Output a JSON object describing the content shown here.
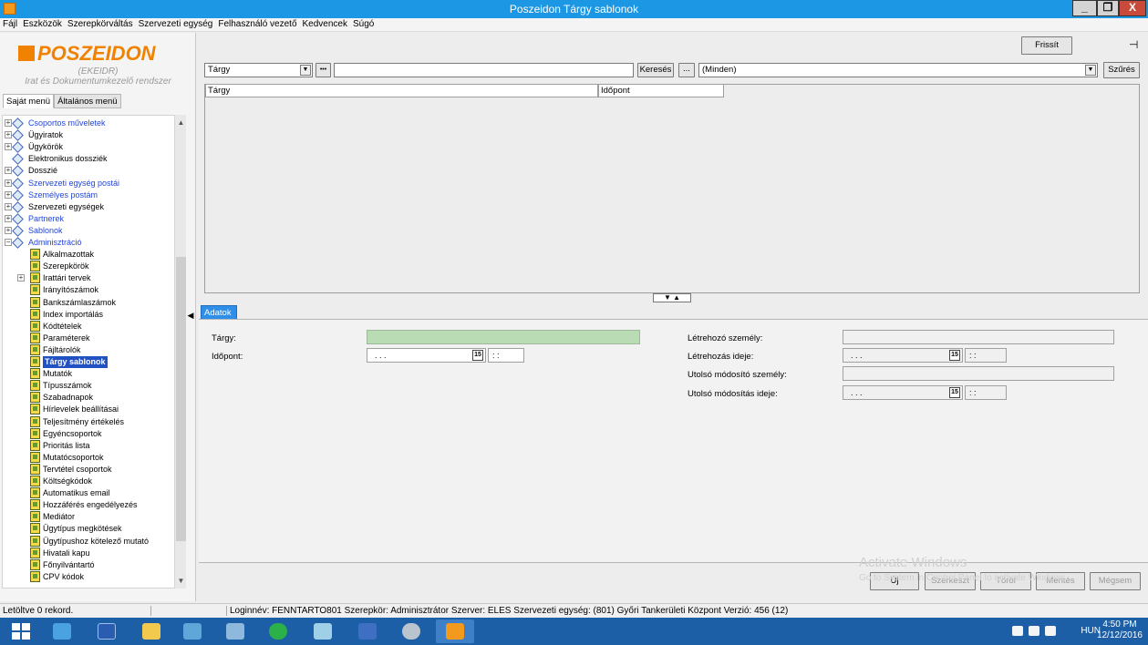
{
  "window": {
    "title": "Poszeidon Tárgy sablonok",
    "min": "_",
    "max": "❐",
    "close": "X"
  },
  "menu": [
    "Fájl",
    "Eszközök",
    "Szerepkörváltás",
    "Szervezeti egység",
    "Felhasználó vezető",
    "Kedvencek",
    "Súgó"
  ],
  "logo": {
    "name": "POSZEIDON",
    "sub1": "(EKEIDR)",
    "sub2": "Irat és Dokumentumkezelő rendszer"
  },
  "left_tabs": {
    "own": "Saját menü",
    "general": "Általános menü"
  },
  "tree": [
    {
      "label": "Csoportos műveletek",
      "type": "folder",
      "expand": "+",
      "blue": true
    },
    {
      "label": "Ügyiratok",
      "type": "folder",
      "expand": "+",
      "blue": false
    },
    {
      "label": "Ügykörök",
      "type": "folder",
      "expand": "+",
      "blue": false
    },
    {
      "label": "Elektronikus dossziék",
      "type": "folder",
      "expand": "",
      "blue": false
    },
    {
      "label": "Dosszié",
      "type": "folder",
      "expand": "+",
      "blue": false
    },
    {
      "label": "Szervezeti egység postái",
      "type": "folder",
      "expand": "+",
      "blue": true
    },
    {
      "label": "Személyes postám",
      "type": "folder",
      "expand": "+",
      "blue": true
    },
    {
      "label": "Szervezeti egységek",
      "type": "folder",
      "expand": "+",
      "blue": false
    },
    {
      "label": "Partnerek",
      "type": "folder",
      "expand": "+",
      "blue": true
    },
    {
      "label": "Sablonok",
      "type": "folder",
      "expand": "+",
      "blue": true
    },
    {
      "label": "Adminisztráció",
      "type": "folder",
      "expand": "−",
      "blue": true
    },
    {
      "label": "Alkalmazottak",
      "type": "doc"
    },
    {
      "label": "Szerepkörök",
      "type": "doc"
    },
    {
      "label": "Irattári tervek",
      "type": "doc",
      "expand": "+"
    },
    {
      "label": "Irányítószámok",
      "type": "doc"
    },
    {
      "label": "Bankszámlaszámok",
      "type": "doc"
    },
    {
      "label": "Index importálás",
      "type": "doc"
    },
    {
      "label": "Kódtételek",
      "type": "doc"
    },
    {
      "label": "Paraméterek",
      "type": "doc"
    },
    {
      "label": "Fájltárolók",
      "type": "doc"
    },
    {
      "label": "Tárgy sablonok",
      "type": "doc",
      "selected": true
    },
    {
      "label": "Mutatók",
      "type": "doc"
    },
    {
      "label": "Típusszámok",
      "type": "doc"
    },
    {
      "label": "Szabadnapok",
      "type": "doc"
    },
    {
      "label": "Hírlevelek beállításai",
      "type": "doc"
    },
    {
      "label": "Teljesítmény értékelés",
      "type": "doc"
    },
    {
      "label": "Egyéncsoportok",
      "type": "doc"
    },
    {
      "label": "Prioritás lista",
      "type": "doc"
    },
    {
      "label": "Mutatócsoportok",
      "type": "doc"
    },
    {
      "label": "Tervtétel csoportok",
      "type": "doc"
    },
    {
      "label": "Költségkódok",
      "type": "doc"
    },
    {
      "label": "Automatikus email",
      "type": "doc"
    },
    {
      "label": "Hozzáférés engedélyezés",
      "type": "doc"
    },
    {
      "label": "Mediátor",
      "type": "doc"
    },
    {
      "label": "Ügytípus megkötések",
      "type": "doc"
    },
    {
      "label": "Ügytípushoz kötelező mutató",
      "type": "doc"
    },
    {
      "label": "Hivatali kapu",
      "type": "doc"
    },
    {
      "label": "Főnyilvántartó",
      "type": "doc"
    },
    {
      "label": "CPV kódok",
      "type": "doc"
    }
  ],
  "toolbar": {
    "refresh": "Frissít",
    "pin": "⊣",
    "field_select": "Tárgy",
    "dots": "•••",
    "search_value": "",
    "search_btn": "Keresés",
    "ellipsis_btn": "...",
    "filter_select": "(Minden)",
    "filter_btn": "Szűrés"
  },
  "grid": {
    "col1": "Tárgy",
    "col2": "Időpont"
  },
  "collapse_arrows": "▼ ▲",
  "data_tab": "Adatok",
  "form": {
    "targy_label": "Tárgy:",
    "idopont_label": "Időpont:",
    "date_placeholder": ". . .",
    "time_placeholder": ": :",
    "cal_icon": "15",
    "letrehozo_label": "Létrehozó személy:",
    "letrehozas_label": "Létrehozás ideje:",
    "utolso_modosito_label": "Utolsó módosító személy:",
    "utolso_modositas_label": "Utolsó módosítás ideje:"
  },
  "bottom_buttons": {
    "new": "Új",
    "edit": "Szerkeszt",
    "delete": "Töröl",
    "save": "Mentés",
    "cancel": "Mégsem"
  },
  "watermark": {
    "line1": "Activate Windows",
    "line2": "Go to System in Control Panel to activate Windows."
  },
  "status": {
    "records": "Letöltve 0 rekord.",
    "info": "Loginnév: FENNTARTO801   Szerepkör: Adminisztrátor   Szerver: ELES   Szervezeti egység: (801) Győri Tankerületi Központ   Verzió: 456 (12)"
  },
  "taskbar": {
    "lang": "HUN",
    "time": "4:50 PM",
    "date": "12/12/2016"
  }
}
